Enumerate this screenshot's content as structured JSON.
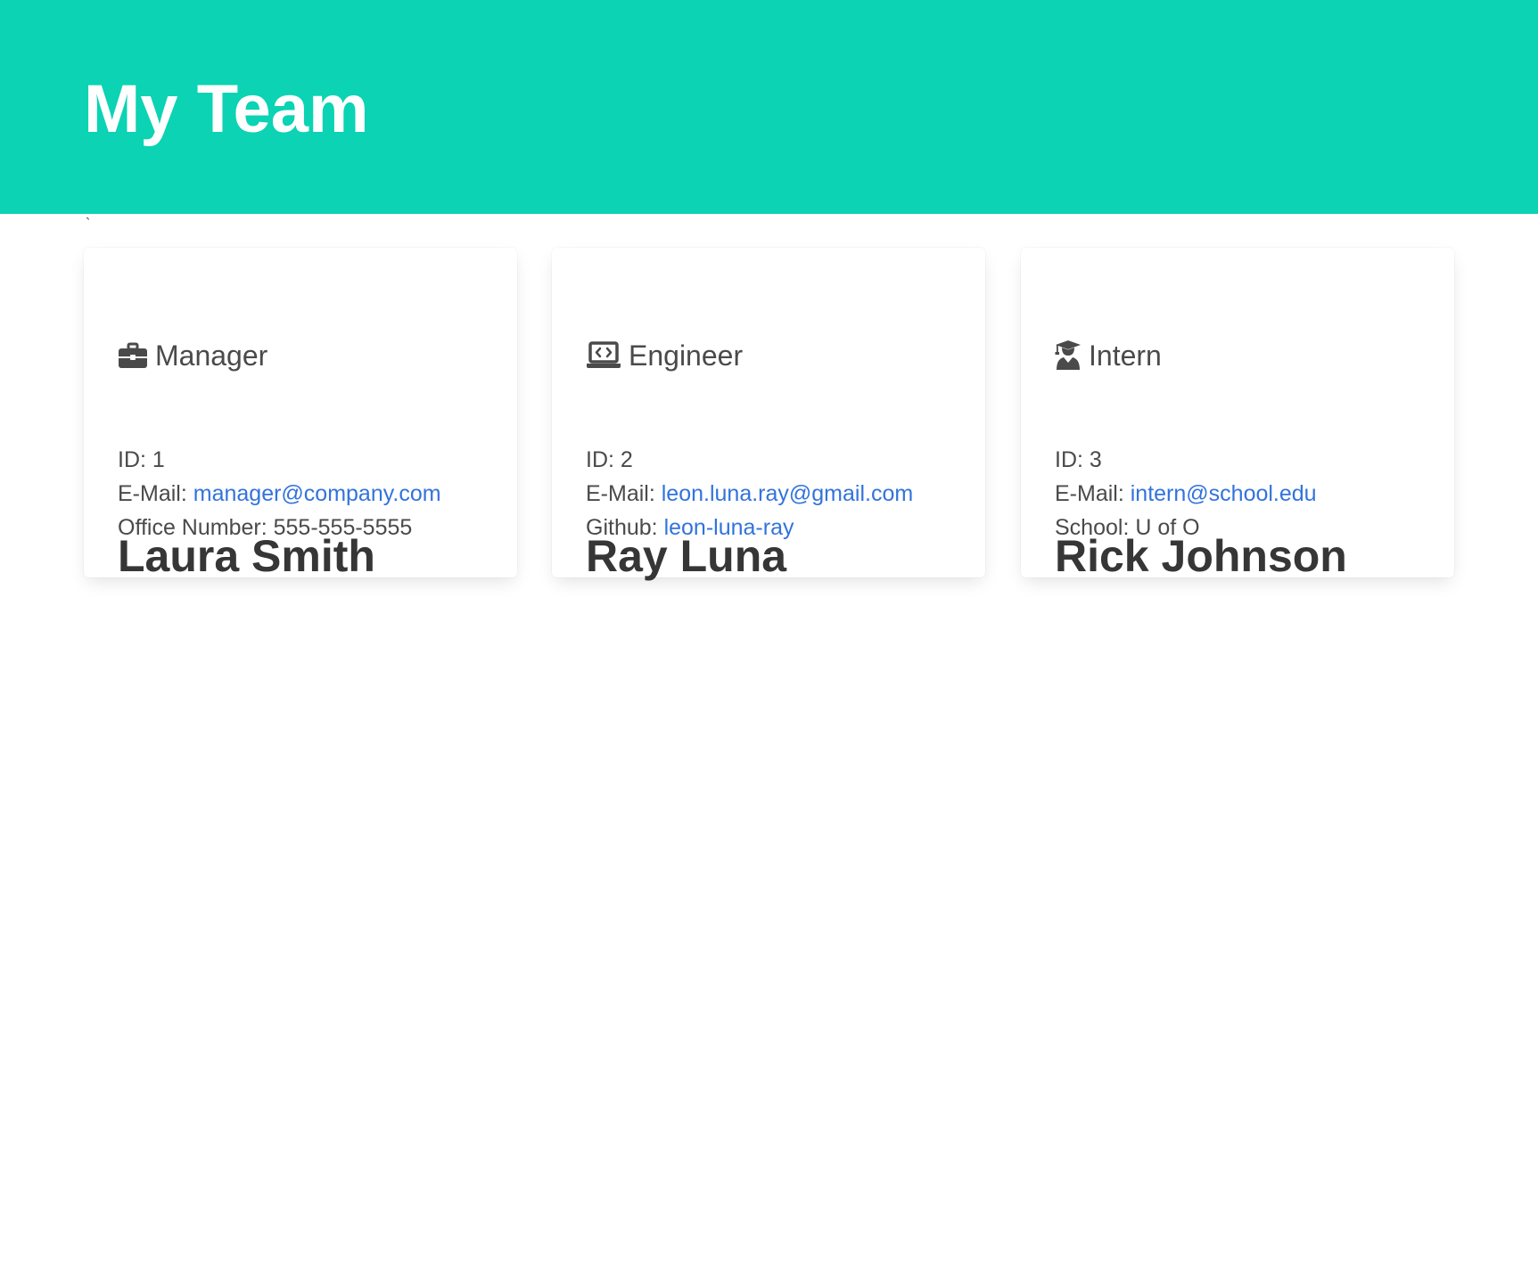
{
  "header": {
    "title": "My Team"
  },
  "stray_char": "`",
  "colors": {
    "hero_bg": "#0bd3b3",
    "link": "#3273dc",
    "text": "#363636"
  },
  "team": [
    {
      "name": "Laura Smith",
      "role": "Manager",
      "icon": "briefcase-icon",
      "id_label": "ID:",
      "id": "1",
      "email_label": "E-Mail:",
      "email": "manager@company.com",
      "extra_label": "Office Number:",
      "extra_value": "555-555-5555"
    },
    {
      "name": "Ray Luna",
      "role": "Engineer",
      "icon": "laptop-code-icon",
      "id_label": "ID:",
      "id": "2",
      "email_label": "E-Mail:",
      "email": "leon.luna.ray@gmail.com",
      "extra_label": "Github:",
      "extra_value": "leon-luna-ray"
    },
    {
      "name": "Rick Johnson",
      "role": "Intern",
      "icon": "graduate-icon",
      "id_label": "ID:",
      "id": "3",
      "email_label": "E-Mail:",
      "email": "intern@school.edu",
      "extra_label": "School:",
      "extra_value": "U of O"
    }
  ]
}
